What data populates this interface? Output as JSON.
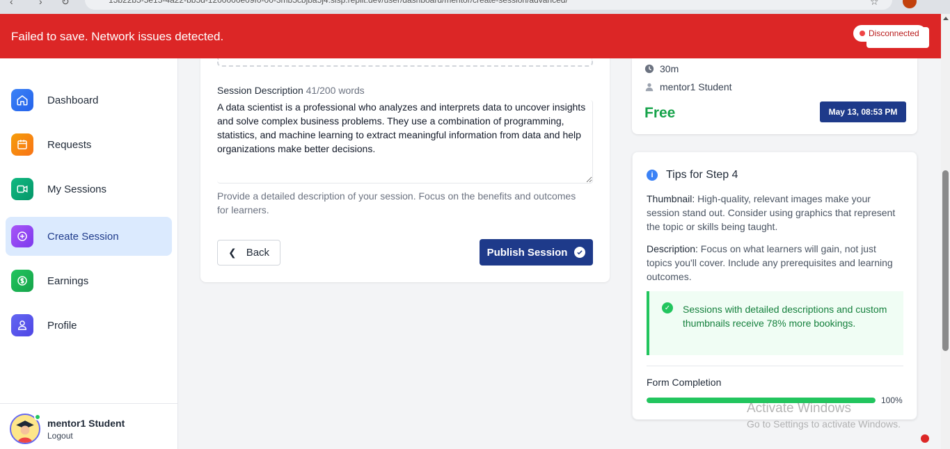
{
  "browser": {
    "url": "15b22b5-5e15-4a22-bb5d-1200000e09f0-00-3mb5cbjba5j4.sisp.replit.dev/user/dashboard/mentor/create-session/advanced/"
  },
  "banner": {
    "message": "Failed to save. Network issues detected.",
    "status": "Disconnected",
    "color": "#dc2626"
  },
  "sidebar": {
    "items": [
      {
        "label": "Dashboard",
        "icon": "home-icon"
      },
      {
        "label": "Requests",
        "icon": "calendar-icon"
      },
      {
        "label": "My Sessions",
        "icon": "video-icon"
      },
      {
        "label": "Create Session",
        "icon": "plus-circle-icon",
        "active": true
      },
      {
        "label": "Earnings",
        "icon": "dollar-icon"
      },
      {
        "label": "Profile",
        "icon": "user-icon"
      }
    ],
    "user": {
      "name": "mentor1 Student",
      "logout": "Logout"
    }
  },
  "form": {
    "description_label": "Session Description",
    "word_count": "41/200 words",
    "description_value": "A data scientist is a professional who analyzes and interprets data to uncover insights and solve complex business problems. They use a combination of programming, statistics, and machine learning to extract meaningful information from data and help organizations make better decisions.",
    "help_text": "Provide a detailed description of your session. Focus on the benefits and outcomes for learners.",
    "back_label": "Back",
    "publish_label": "Publish Session"
  },
  "preview": {
    "duration": "30m",
    "mentor": "mentor1 Student",
    "price": "Free",
    "date": "May 13, 08:53 PM"
  },
  "tips": {
    "title": "Tips for Step 4",
    "thumbnail_label": "Thumbnail:",
    "thumbnail_text": " High-quality, relevant images make your session stand out. Consider using graphics that represent the topic or skills being taught.",
    "description_label": "Description:",
    "description_text": " Focus on what learners will gain, not just topics you'll cover. Include any prerequisites and learning outcomes.",
    "callout": "Sessions with detailed descriptions and custom thumbnails receive 78% more bookings.",
    "completion_label": "Form Completion",
    "completion_value": 1.0,
    "completion_text": "100%"
  },
  "watermark": {
    "title": "Activate Windows",
    "subtitle": "Go to Settings to activate Windows."
  }
}
